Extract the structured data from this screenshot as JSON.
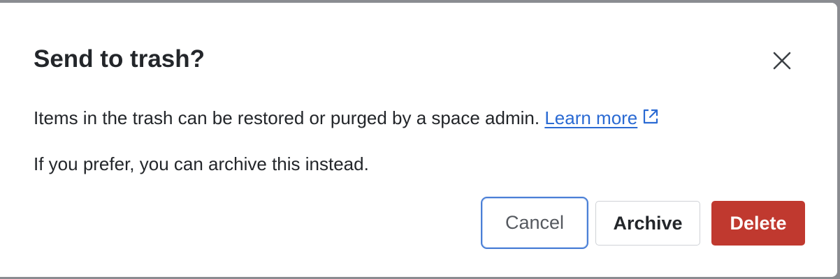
{
  "dialog": {
    "title": "Send to trash?",
    "close_icon": "close-icon",
    "message_line1": "Items in the trash can be restored or purged by a space admin.",
    "learn_more_label": "Learn more",
    "external_link_icon": "external-link-icon",
    "message_line2": "If you prefer, you can archive this instead.",
    "buttons": {
      "cancel_label": "Cancel",
      "archive_label": "Archive",
      "delete_label": "Delete"
    }
  },
  "colors": {
    "backdrop": "#8a8c91",
    "link": "#2a6ad3",
    "focus_ring": "#4a7fd6",
    "danger": "#c0392f",
    "text": "#23262a"
  }
}
